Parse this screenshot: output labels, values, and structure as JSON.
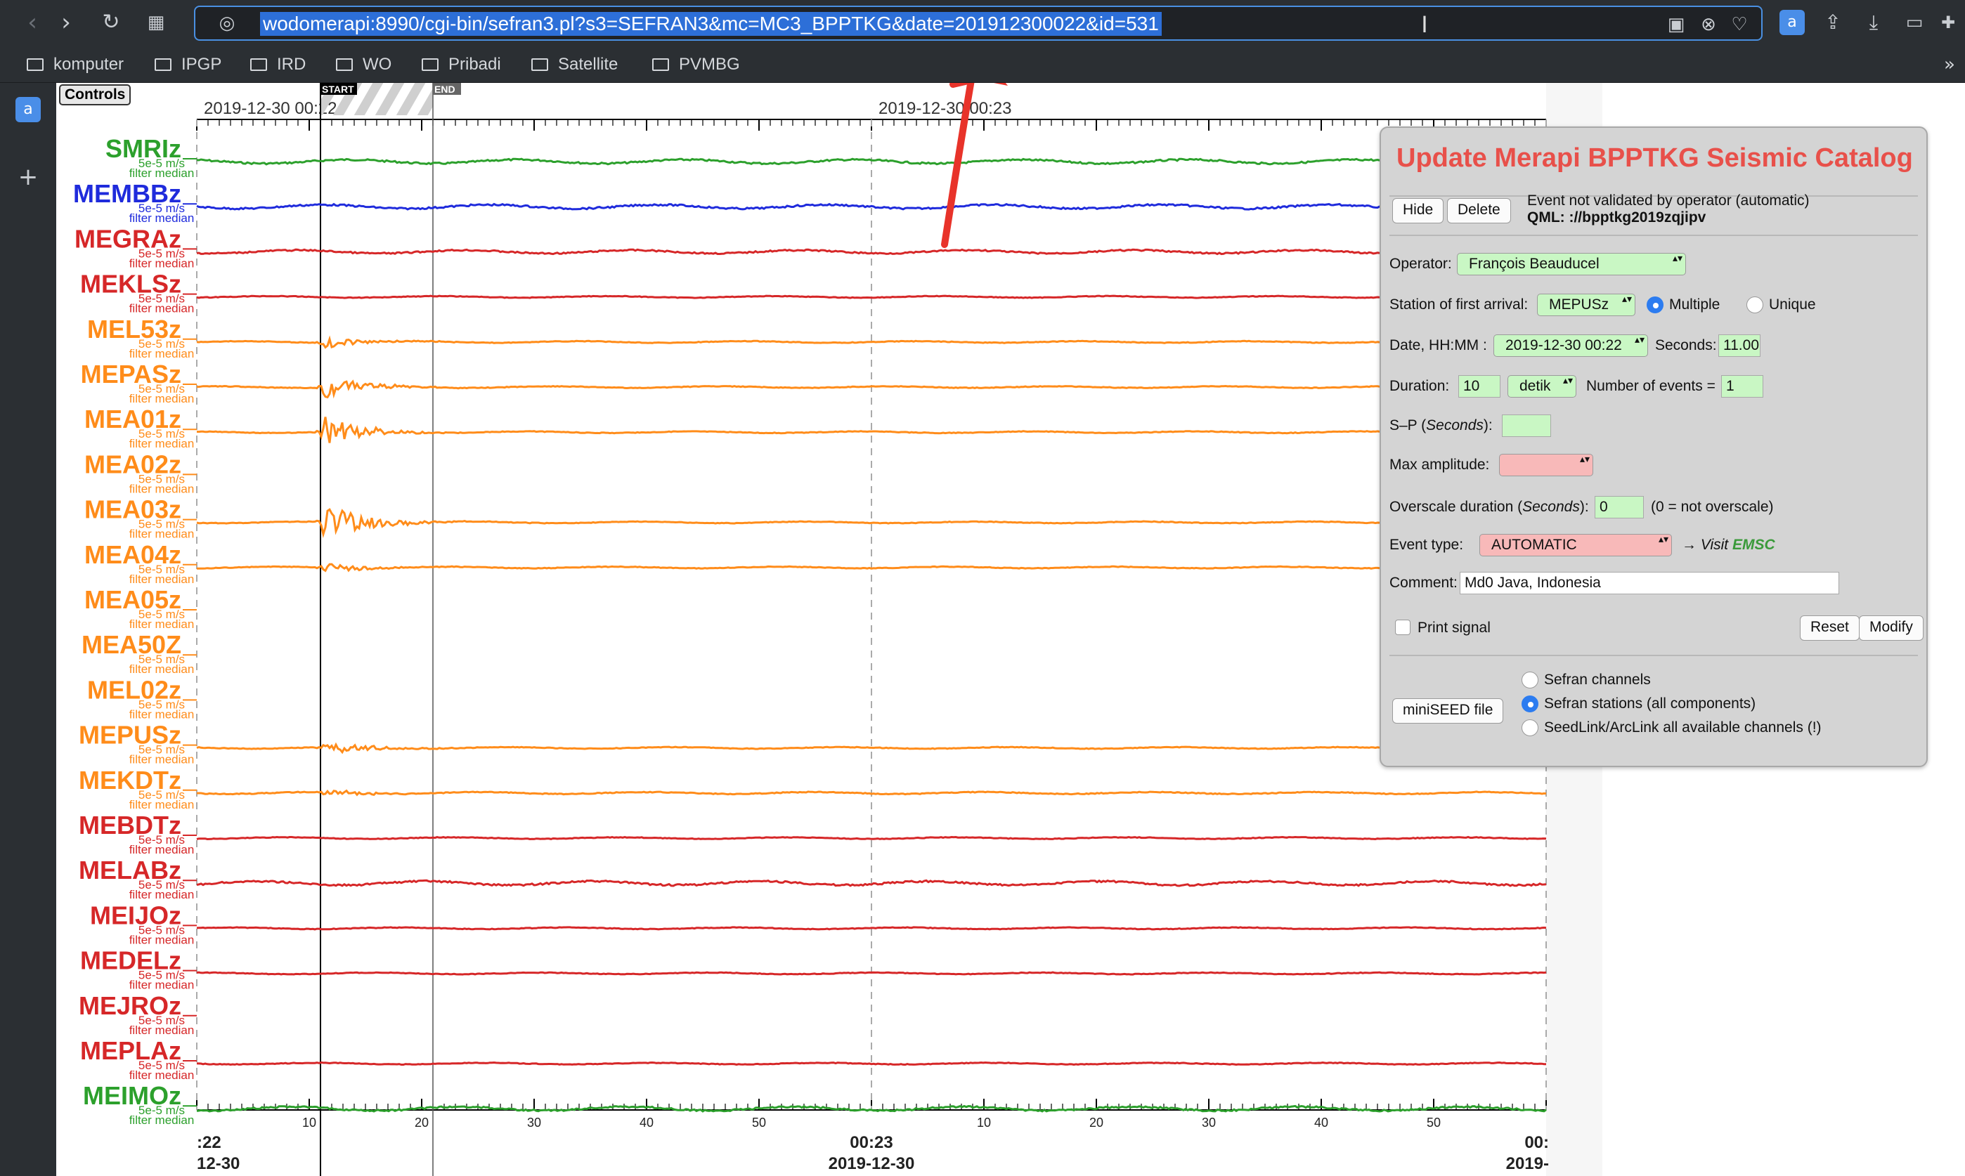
{
  "browser": {
    "url": "wodomerapi:8990/cgi-bin/sefran3.pl?s3=SEFRAN3&mc=MC3_BPPTKG&date=201912300022&id=531",
    "bookmarks": [
      "komputer",
      "IPGP",
      "IRD",
      "WO",
      "Pribadi",
      "Satellite",
      "PVMBG"
    ]
  },
  "page": {
    "controls_label": "Controls",
    "start_label": "START",
    "end_label": "END",
    "minute_labels": [
      "2019-12-30 00:22",
      "2019-12-30 00:23"
    ],
    "tick_labels": [
      "10",
      "20",
      "30",
      "40",
      "50",
      "10",
      "20",
      "30",
      "40",
      "50"
    ],
    "bottom_time_labels": [
      ":22",
      "00:23",
      "00:"
    ],
    "bottom_date_labels": [
      "12-30",
      "2019-12-30",
      "2019-"
    ],
    "channel_scale": "5e-5 m/s",
    "channel_filter": "filter median",
    "channels": [
      {
        "name": "SMRIz",
        "color": "#2ca02c",
        "amp": 3,
        "event": 0
      },
      {
        "name": "MEMBBz",
        "color": "#1f2bdc",
        "amp": 3,
        "event": 0
      },
      {
        "name": "MEGRAz",
        "color": "#d62728",
        "amp": 2.5,
        "event": 0
      },
      {
        "name": "MEKLSz",
        "color": "#d62728",
        "amp": 1.2,
        "event": 0
      },
      {
        "name": "MEL53z",
        "color": "#ff8c1a",
        "amp": 1.2,
        "event": 8
      },
      {
        "name": "MEPASz",
        "color": "#ff8c1a",
        "amp": 1.2,
        "event": 16
      },
      {
        "name": "MEA01z",
        "color": "#ff8c1a",
        "amp": 1.2,
        "event": 22
      },
      {
        "name": "MEA02z",
        "color": "#ff8c1a",
        "amp": 0,
        "event": 0
      },
      {
        "name": "MEA03z",
        "color": "#ff8c1a",
        "amp": 1.2,
        "event": 30
      },
      {
        "name": "MEA04z",
        "color": "#ff8c1a",
        "amp": 1.2,
        "event": 7
      },
      {
        "name": "MEA05z",
        "color": "#ff8c1a",
        "amp": 0,
        "event": 0
      },
      {
        "name": "MEA50Z",
        "color": "#ff8c1a",
        "amp": 0,
        "event": 0
      },
      {
        "name": "MEL02z",
        "color": "#ff8c1a",
        "amp": 0,
        "event": 0
      },
      {
        "name": "MEPUSz",
        "color": "#ff8c1a",
        "amp": 1.2,
        "event": 12
      },
      {
        "name": "MEKDTz",
        "color": "#ff8c1a",
        "amp": 1.5,
        "event": 5
      },
      {
        "name": "MEBDTz",
        "color": "#d62728",
        "amp": 1.2,
        "event": 0
      },
      {
        "name": "MELABz",
        "color": "#d62728",
        "amp": 3,
        "event": 0
      },
      {
        "name": "MEIJOz",
        "color": "#d62728",
        "amp": 1.2,
        "event": 0
      },
      {
        "name": "MEDELz",
        "color": "#d62728",
        "amp": 1.2,
        "event": 0
      },
      {
        "name": "MEJROz",
        "color": "#d62728",
        "amp": 0,
        "event": 0
      },
      {
        "name": "MEPLAz",
        "color": "#d62728",
        "amp": 1.2,
        "event": 0
      },
      {
        "name": "MEIMOz",
        "color": "#2ca02c",
        "amp": 3,
        "event": 0
      }
    ]
  },
  "dialog": {
    "title": "Update Merapi BPPTKG Seismic Catalog",
    "hide_label": "Hide",
    "delete_label": "Delete",
    "status_text": "Event not validated by operator (automatic)",
    "qml_label": "QML: ",
    "qml_value": "://bpptkg2019zqjipv",
    "operator_label": "Operator:",
    "operator_value": "François Beauducel",
    "station_label": "Station of first arrival:",
    "station_value": "MEPUSz",
    "multiple_label": "Multiple",
    "unique_label": "Unique",
    "date_label": "Date, HH:MM :",
    "date_value": "2019-12-30 00:22",
    "seconds_label": "Seconds:",
    "seconds_value": "11.00",
    "duration_label": "Duration:",
    "duration_value": "10",
    "duration_unit": "detik",
    "nevents_label": "Number of events =",
    "nevents_value": "1",
    "sp_label_pre": "S–P (",
    "sp_label_em": "Seconds",
    "sp_label_post": "):",
    "maxamp_label": "Max amplitude:",
    "overscale_label_pre": "Overscale duration (",
    "overscale_label_em": "Seconds",
    "overscale_label_post": "):",
    "overscale_value": "0",
    "overscale_note": "(0 = not overscale)",
    "eventtype_label": "Event type:",
    "eventtype_value": "AUTOMATIC",
    "visit_label": "→ Visit ",
    "visit_link": "EMSC",
    "comment_label": "Comment:",
    "comment_value": "Md0 Java, Indonesia",
    "print_label": "Print signal",
    "reset_label": "Reset",
    "modify_label": "Modify",
    "miniseed_label": "miniSEED file",
    "opt1": "Sefran channels",
    "opt2": "Sefran stations (all components)",
    "opt3": "SeedLink/ArcLink all available channels (!)"
  },
  "colors": {
    "title_red": "#e8504a",
    "select_green": "#c9f7c4",
    "select_pink": "#f8b9b9",
    "arrow_red": "#e8332a",
    "emsc_green": "#3a9a3a"
  },
  "icons": [
    "back-icon",
    "forward-icon",
    "reload-icon",
    "grid-icon",
    "globe-icon",
    "cursor-icon",
    "camera-icon",
    "close-circle-icon",
    "heart-icon",
    "translate-icon",
    "share-icon",
    "download-icon",
    "toggle-icon",
    "new-tab-icon",
    "more-icon"
  ]
}
